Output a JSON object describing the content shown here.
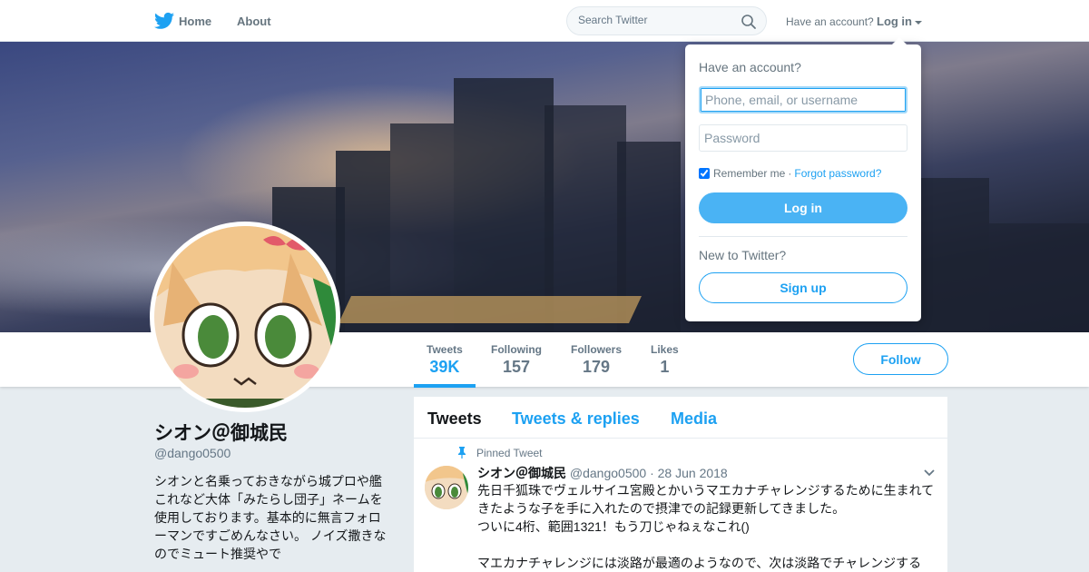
{
  "nav": {
    "home_label": "Home",
    "about_label": "About",
    "search_placeholder": "Search Twitter",
    "have_account_label": "Have an account?",
    "login_label": "Log in"
  },
  "profile": {
    "name": "シオン＠御城民",
    "handle": "@dango0500",
    "bio": "シオンと名乗っておきながら城プロや艦これなど大体「みたらし団子」ネームを使用しております。基本的に無言フォローマンですごめんなさい。 ノイズ撒きなのでミュート推奨やで",
    "follow_label": "Follow"
  },
  "stats": [
    {
      "label": "Tweets",
      "value": "39K"
    },
    {
      "label": "Following",
      "value": "157"
    },
    {
      "label": "Followers",
      "value": "179"
    },
    {
      "label": "Likes",
      "value": "1"
    }
  ],
  "timeline": {
    "tabs": [
      "Tweets",
      "Tweets & replies",
      "Media"
    ],
    "pinned_label": "Pinned Tweet",
    "tweet": {
      "name": "シオン＠御城民",
      "handle": "@dango0500",
      "date": "28 Jun 2018",
      "text": "先日千狐珠でヴェルサイユ宮殿とかいうマエカナチャレンジするために生まれてきたような子を手に入れたので摂津での記録更新してきました。\nついに4桁、範囲1321！もう刀じゃねぇなこれ()\n\nマエカナチャレンジには淡路が最適のようなので、次は淡路でチャレンジする"
    }
  },
  "login_dropdown": {
    "title": "Have an account?",
    "username_placeholder": "Phone, email, or username",
    "password_placeholder": "Password",
    "remember_label": "Remember me",
    "separator": "·",
    "forgot_label": "Forgot password?",
    "login_button": "Log in",
    "new_label": "New to Twitter?",
    "signup_button": "Sign up"
  },
  "colors": {
    "brand": "#1da1f2",
    "login_button": "#4ab3f4",
    "page_background": "#e6ecf0"
  }
}
